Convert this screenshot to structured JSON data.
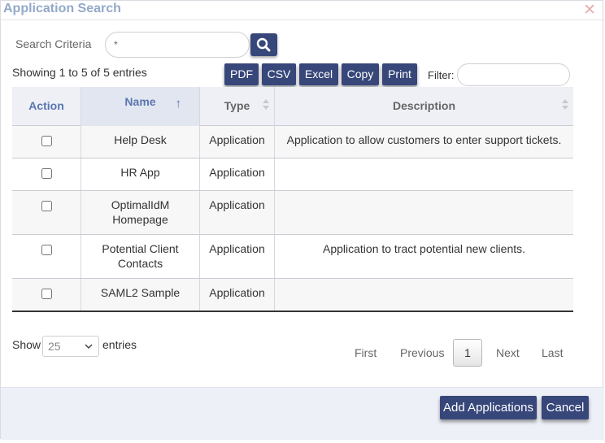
{
  "dialog": {
    "title": "Application Search",
    "close_icon": "close-icon"
  },
  "search": {
    "label": "Search Criteria",
    "value": "*",
    "button_icon": "search-icon"
  },
  "info": {
    "showing": "Showing 1 to 5 of 5 entries"
  },
  "export_buttons": [
    "PDF",
    "CSV",
    "Excel",
    "Copy",
    "Print"
  ],
  "filter": {
    "label": "Filter:",
    "value": ""
  },
  "table": {
    "columns": [
      "Action",
      "Name",
      "Type",
      "Description"
    ],
    "sort_indicator": "↑",
    "rows": [
      {
        "checked": false,
        "name": "Help Desk",
        "type": "Application",
        "description": "Application to allow customers to enter support tickets."
      },
      {
        "checked": false,
        "name": "HR App",
        "type": "Application",
        "description": ""
      },
      {
        "checked": false,
        "name": "OptimalIdM Homepage",
        "type": "Application",
        "description": ""
      },
      {
        "checked": false,
        "name": "Potential Client Contacts",
        "type": "Application",
        "description": "Application to tract potential new clients."
      },
      {
        "checked": false,
        "name": "SAML2 Sample",
        "type": "Application",
        "description": ""
      }
    ]
  },
  "length": {
    "show_label": "Show",
    "value": "25",
    "entries_label": "entries"
  },
  "pagination": {
    "first": "First",
    "previous": "Previous",
    "current": "1",
    "next": "Next",
    "last": "Last"
  },
  "footer": {
    "add": "Add Applications",
    "cancel": "Cancel"
  },
  "colors": {
    "button_bg": "#37477a",
    "title_color": "#93a9c9",
    "header_bg": "#eef0f6",
    "footer_bg": "#edf0f6"
  }
}
